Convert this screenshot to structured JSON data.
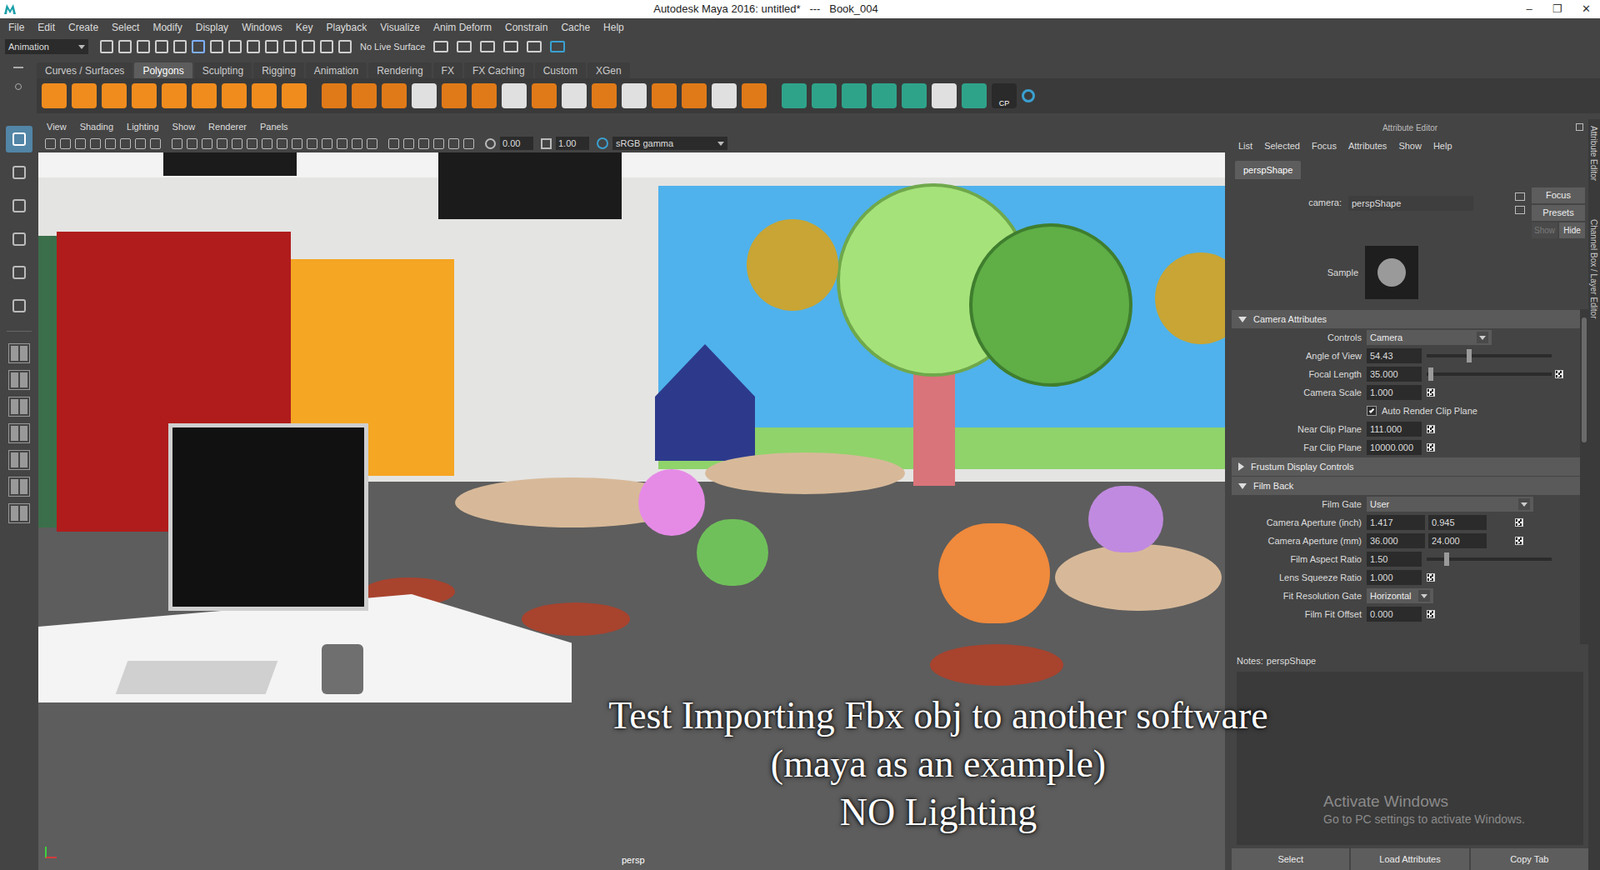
{
  "window": {
    "title": "Autodesk Maya 2016: untitled*   ---   Book_004",
    "controls": [
      "–",
      "❐",
      "✕"
    ]
  },
  "menu": [
    "File",
    "Edit",
    "Create",
    "Select",
    "Modify",
    "Display",
    "Windows",
    "Key",
    "Playback",
    "Visualize",
    "Anim Deform",
    "Constrain",
    "Cache",
    "Help"
  ],
  "status_line": {
    "mode": "Animation",
    "live_surface": "No Live Surface"
  },
  "shelf_tabs": [
    {
      "label": "Curves / Surfaces",
      "selected": false
    },
    {
      "label": "Polygons",
      "selected": true
    },
    {
      "label": "Sculpting",
      "selected": false
    },
    {
      "label": "Rigging",
      "selected": false
    },
    {
      "label": "Animation",
      "selected": false
    },
    {
      "label": "Rendering",
      "selected": false
    },
    {
      "label": "FX",
      "selected": false
    },
    {
      "label": "FX Caching",
      "selected": false
    },
    {
      "label": "Custom",
      "selected": false
    },
    {
      "label": "XGen",
      "selected": false
    }
  ],
  "shelf_cp_label": "CP",
  "viewport": {
    "menu": [
      "View",
      "Shading",
      "Lighting",
      "Show",
      "Renderer",
      "Panels"
    ],
    "exposure": "0.00",
    "gamma": "1.00",
    "color_space": "sRGB gamma",
    "camera": "persp"
  },
  "caption": [
    "Test Importing Fbx obj to another software",
    "(maya as an example)",
    "NO Lighting"
  ],
  "attribute_editor": {
    "title": "Attribute Editor",
    "menu": [
      "List",
      "Selected",
      "Focus",
      "Attributes",
      "Show",
      "Help"
    ],
    "tab": "perspShape",
    "camera_label": "camera:",
    "camera_value": "perspShape",
    "side_buttons": [
      {
        "label": "Focus",
        "disabled": false
      },
      {
        "label": "Presets",
        "disabled": false
      }
    ],
    "show_hide": [
      {
        "label": "Show",
        "disabled": true
      },
      {
        "label": "Hide",
        "disabled": false
      }
    ],
    "sample_label": "Sample",
    "sections": [
      {
        "title": "Camera Attributes",
        "expanded": true,
        "rows": [
          {
            "kind": "dropdown",
            "label": "Controls",
            "value": "Camera"
          },
          {
            "kind": "slider",
            "label": "Angle of View",
            "value": "54.43",
            "level": 0.34
          },
          {
            "kind": "slider",
            "label": "Focal Length",
            "value": "35.000",
            "level": 0.03
          },
          {
            "kind": "field",
            "label": "Camera Scale",
            "value": "1.000"
          },
          {
            "kind": "checkbox",
            "label": "Auto Render Clip Plane",
            "checked": true
          },
          {
            "kind": "field",
            "label": "Near Clip Plane",
            "value": "111.000"
          },
          {
            "kind": "field",
            "label": "Far Clip Plane",
            "value": "10000.000"
          }
        ]
      },
      {
        "title": "Frustum Display Controls",
        "expanded": false,
        "rows": []
      },
      {
        "title": "Film Back",
        "expanded": true,
        "rows": [
          {
            "kind": "dropdown",
            "label": "Film Gate",
            "value": "User"
          },
          {
            "kind": "pair",
            "label": "Camera Aperture (inch)",
            "values": [
              "1.417",
              "0.945"
            ]
          },
          {
            "kind": "pair",
            "label": "Camera Aperture (mm)",
            "values": [
              "36.000",
              "24.000"
            ]
          },
          {
            "kind": "slider",
            "label": "Film Aspect Ratio",
            "value": "1.50",
            "level": 0.16
          },
          {
            "kind": "field",
            "label": "Lens Squeeze Ratio",
            "value": "1.000"
          },
          {
            "kind": "dropdown",
            "label": "Fit Resolution Gate",
            "value": "Horizontal"
          },
          {
            "kind": "field",
            "label": "Film Fit Offset",
            "value": "0.000"
          }
        ]
      }
    ],
    "notes_label": "Notes:",
    "notes_value": "perspShape",
    "bottom_buttons": [
      "Select",
      "Load Attributes",
      "Copy Tab"
    ]
  },
  "side_tabs": [
    "Attribute Editor",
    "Channel Box / Layer Editor"
  ],
  "watermark": {
    "title": "Activate Windows",
    "subtitle": "Go to PC settings to activate Windows."
  }
}
